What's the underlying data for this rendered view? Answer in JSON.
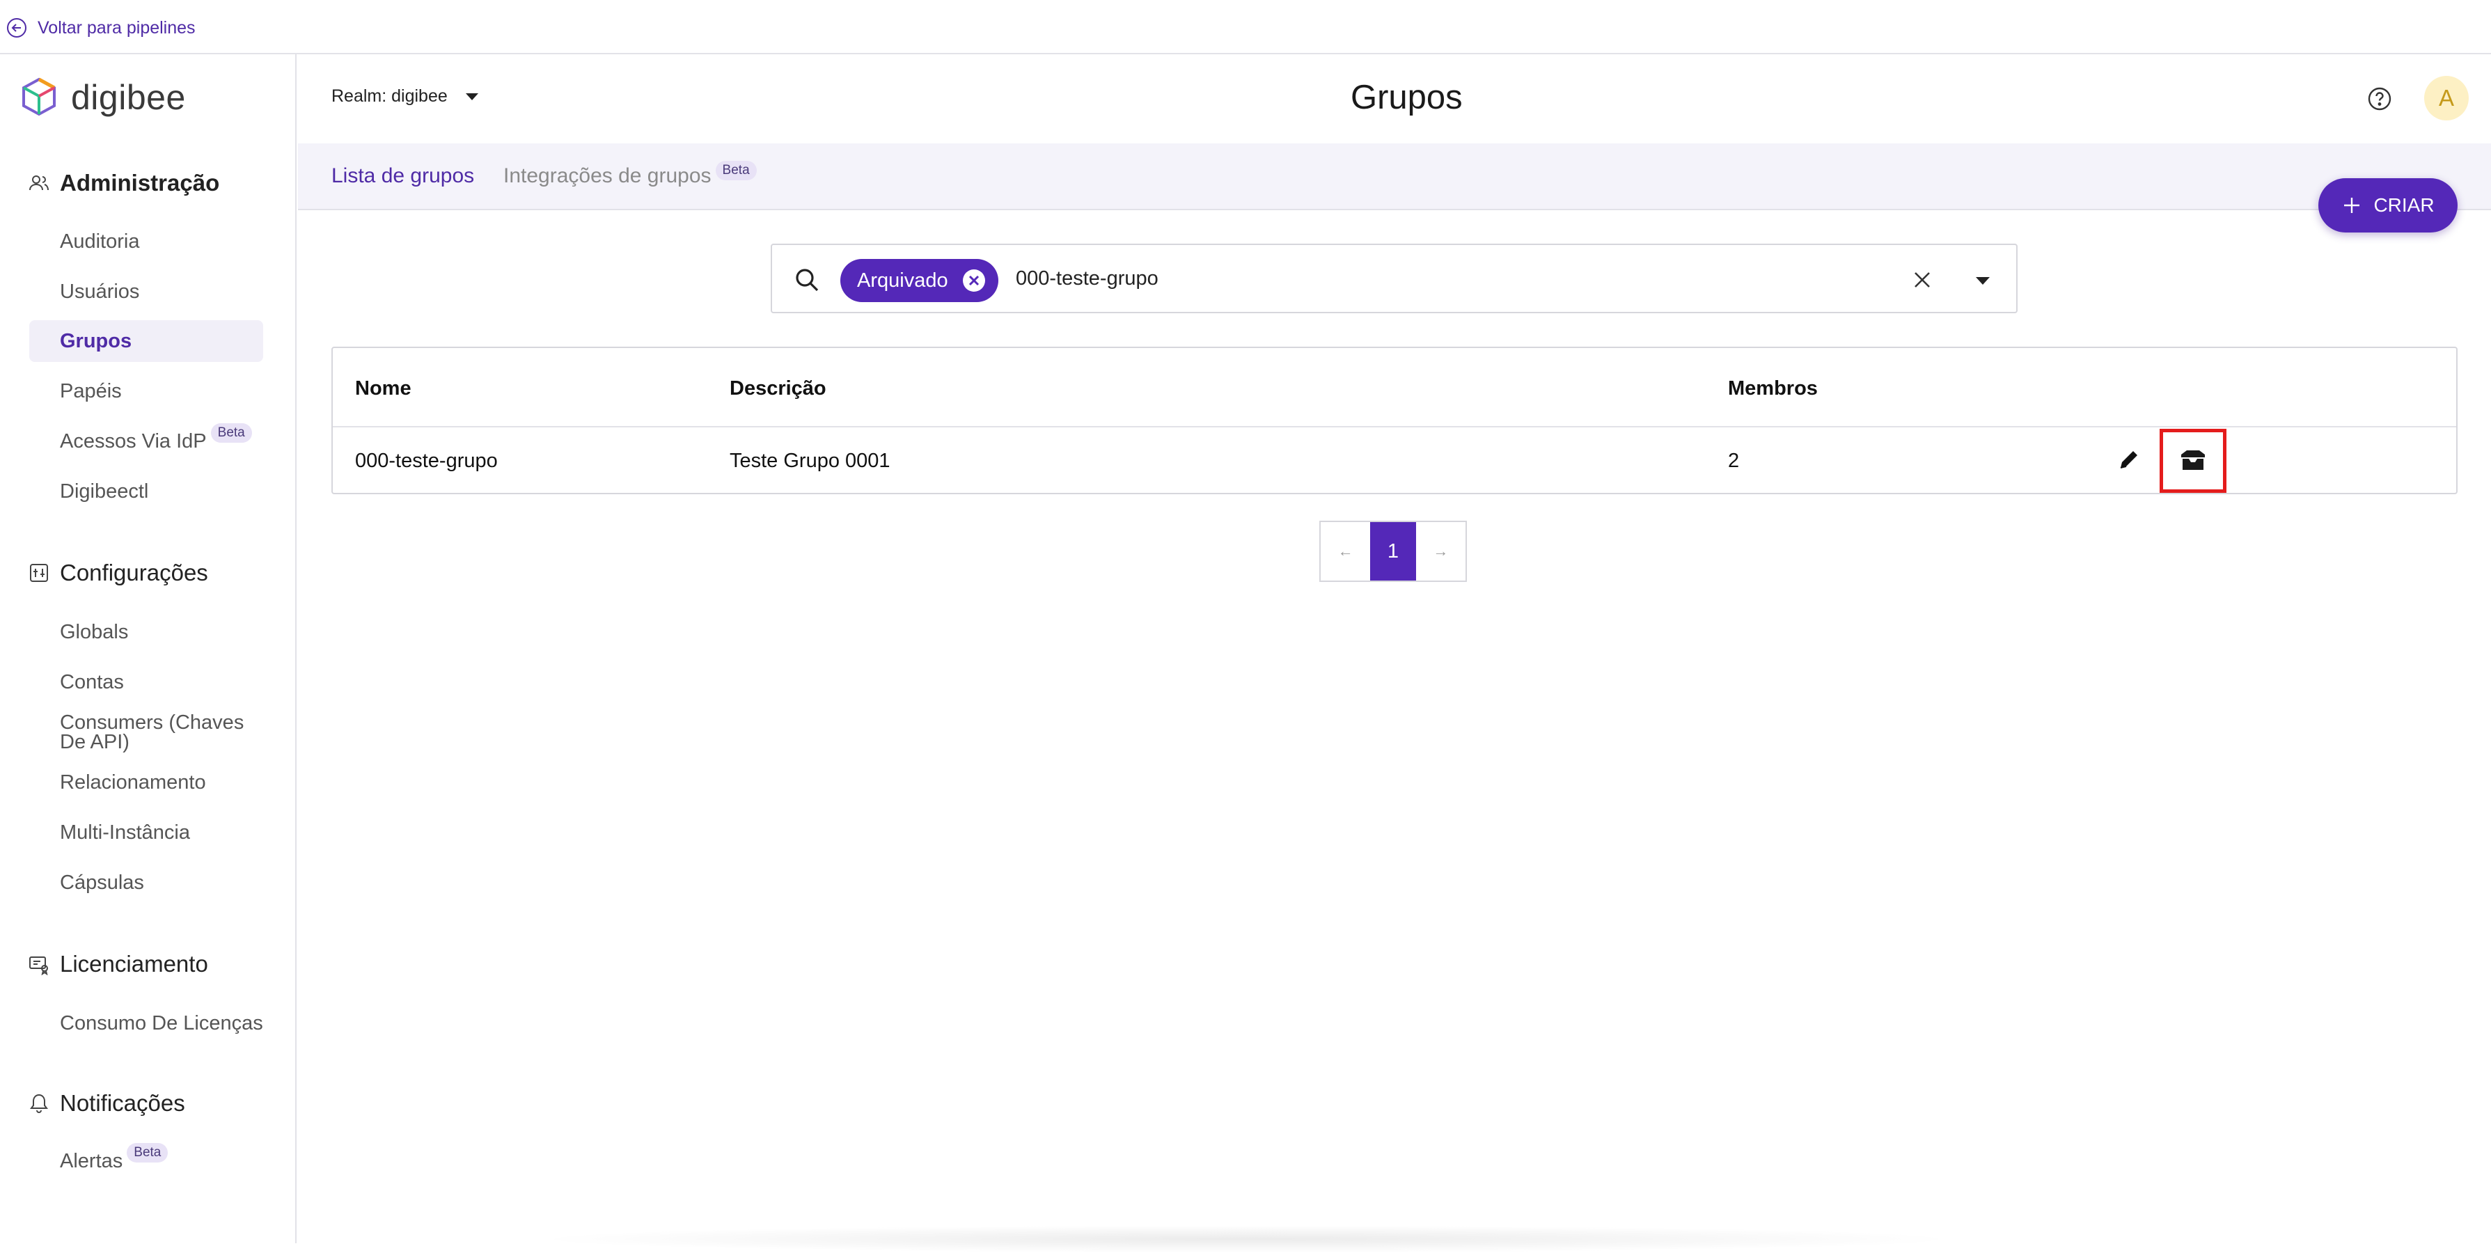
{
  "topbar": {
    "back_label": "Voltar para pipelines"
  },
  "brand": {
    "logo_text": "digibee",
    "accent": "#5428b8"
  },
  "sidebar": {
    "sections": [
      {
        "label": "Administração",
        "icon": "users-icon",
        "items": [
          {
            "label": "Auditoria"
          },
          {
            "label": "Usuários"
          },
          {
            "label": "Grupos",
            "active": true
          },
          {
            "label": "Papéis"
          },
          {
            "label": "Acessos Via IdP",
            "badge": "Beta"
          },
          {
            "label": "Digibeectl"
          }
        ]
      },
      {
        "label": "Configurações",
        "icon": "settings-grid-icon",
        "items": [
          {
            "label": "Globals"
          },
          {
            "label": "Contas"
          },
          {
            "label": "Consumers (Chaves De API)"
          },
          {
            "label": "Relacionamento"
          },
          {
            "label": "Multi-Instância"
          },
          {
            "label": "Cápsulas"
          }
        ]
      },
      {
        "label": "Licenciamento",
        "icon": "license-icon",
        "items": [
          {
            "label": "Consumo De Licenças"
          }
        ]
      },
      {
        "label": "Notificações",
        "icon": "bell-icon",
        "items": [
          {
            "label": "Alertas",
            "badge": "Beta"
          }
        ]
      }
    ]
  },
  "header": {
    "realm": "Realm: digibee",
    "title": "Grupos",
    "avatar_initial": "A"
  },
  "tabs": [
    {
      "label": "Lista de grupos",
      "active": true
    },
    {
      "label": "Integrações de grupos",
      "badge": "Beta"
    }
  ],
  "create_button": {
    "label": "CRIAR"
  },
  "search": {
    "chip_label": "Arquivado",
    "value": "000-teste-grupo"
  },
  "table": {
    "columns": [
      "Nome",
      "Descrição",
      "Membros"
    ],
    "rows": [
      {
        "nome": "000-teste-grupo",
        "descricao": "Teste Grupo 0001",
        "membros": "2"
      }
    ]
  },
  "pagination": {
    "current": "1",
    "prev": "←",
    "next": "→"
  }
}
